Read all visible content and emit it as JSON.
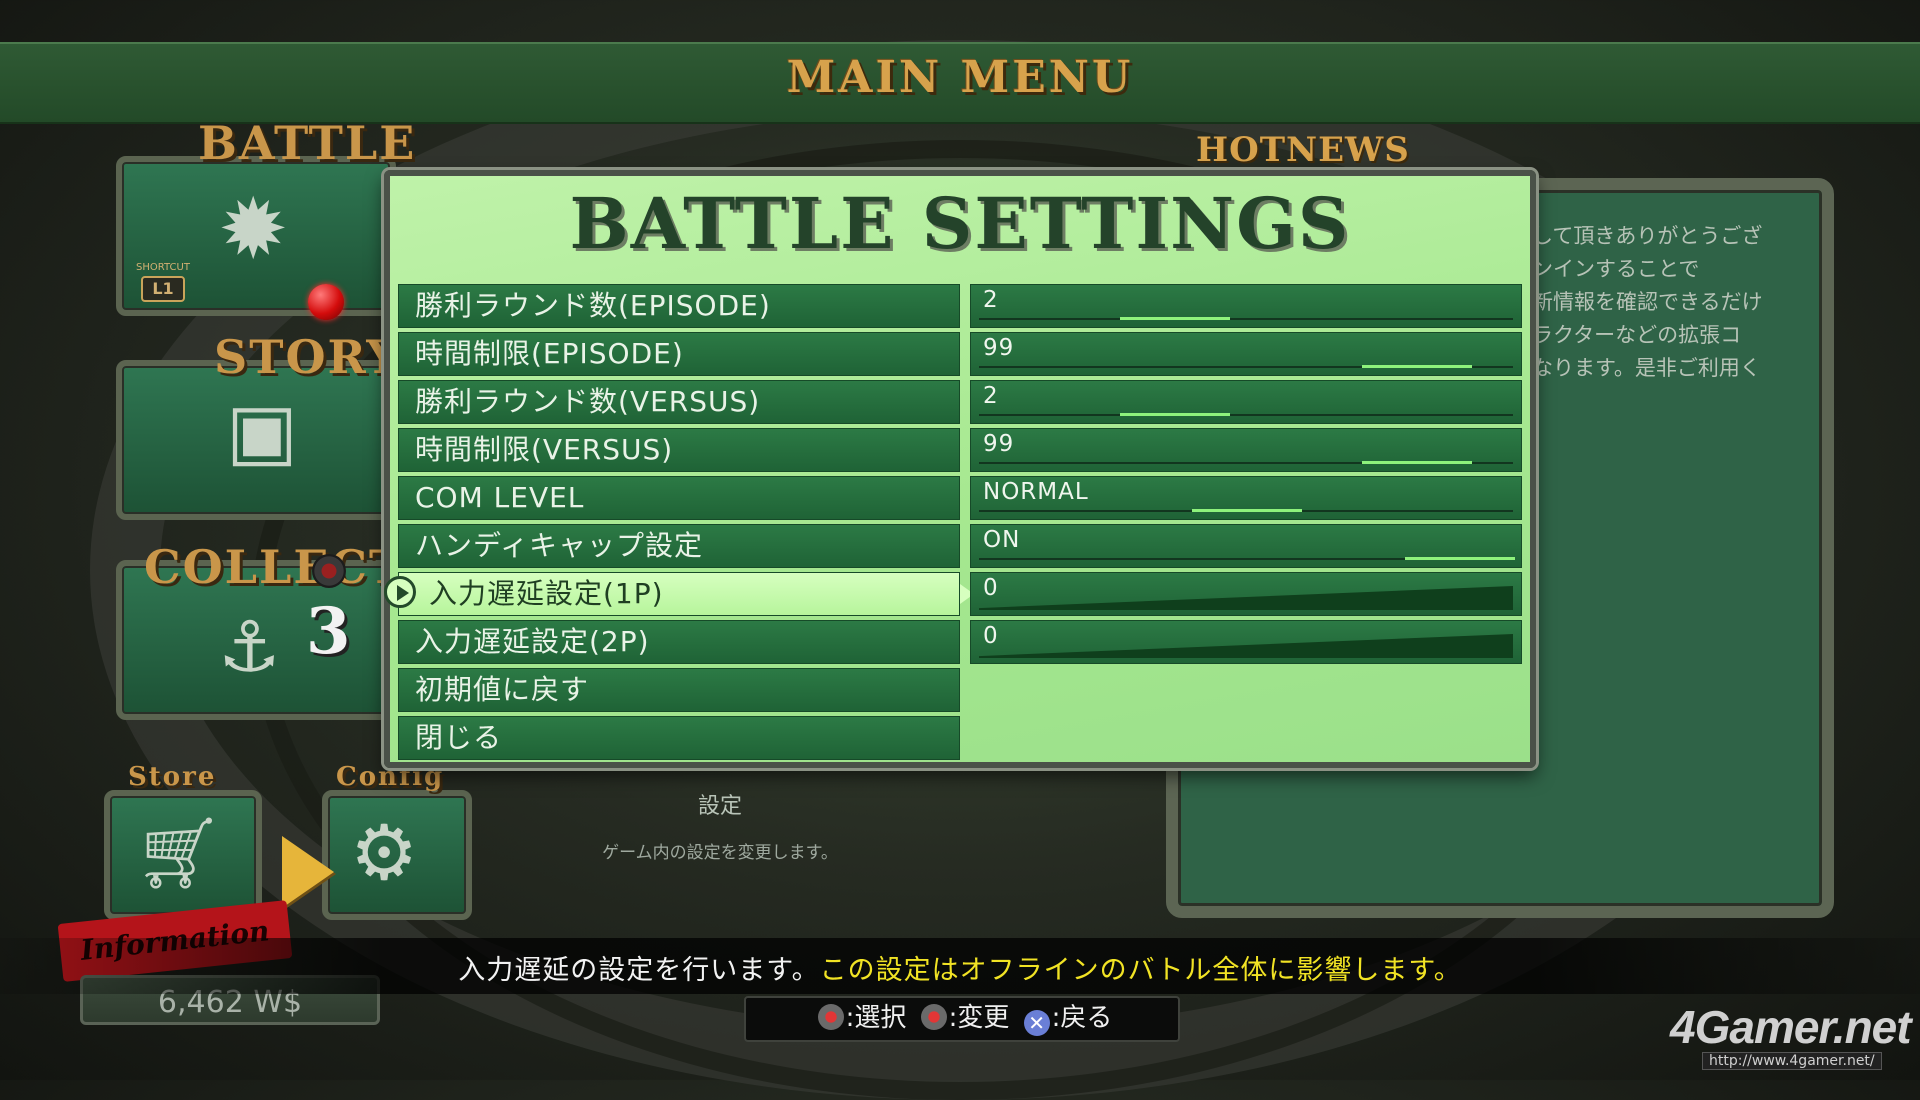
{
  "header": {
    "title": "MAIN MENU"
  },
  "left_menu": {
    "battle_label": "BATTLE",
    "shortcut_caption": "SHORTCUT",
    "shortcut_key": "L1",
    "story_label": "STORY",
    "collection_label": "COLLECTI",
    "collection_badge": "3",
    "store_label": "Store",
    "config_label": "Config",
    "information_label": "Information",
    "currency": "6,462 W$"
  },
  "config_caption": {
    "title": "設定",
    "description": "ゲーム内の設定を変更します。"
  },
  "hotnews": {
    "title": "HOTNEWS",
    "lines": [
      "して頂きありがとうござ",
      "ンインすることで",
      "新情報を確認できるだけ",
      "ラクターなどの拡張コ",
      "なります。是非ご利用く"
    ]
  },
  "dialog": {
    "title": "BATTLE SETTINGS",
    "rows": [
      {
        "label": "勝利ラウンド数(EPISODE)",
        "value": "2",
        "level": 0.33
      },
      {
        "label": "時間制限(EPISODE)",
        "value": "99",
        "level": 0.9
      },
      {
        "label": "勝利ラウンド数(VERSUS)",
        "value": "2",
        "level": 0.33
      },
      {
        "label": "時間制限(VERSUS)",
        "value": "99",
        "level": 0.9
      },
      {
        "label": "COM LEVEL",
        "value": "NORMAL",
        "level": 0.5
      },
      {
        "label": "ハンディキャップ設定",
        "value": "ON",
        "level": 1.0
      },
      {
        "label": "入力遅延設定(1P)",
        "value": "0",
        "selected": true
      },
      {
        "label": "入力遅延設定(2P)",
        "value": "0"
      },
      {
        "label": "初期値に戻す"
      },
      {
        "label": "閉じる"
      }
    ]
  },
  "footer": {
    "message_white": "入力遅延の設定を行います。",
    "message_yellow": "この設定はオフラインのバトル全体に影響します。",
    "select_label": ":選択",
    "change_label": ":変更",
    "back_label": ":戻る"
  },
  "watermark": {
    "logo": "4Gamer.net",
    "url": "http://www.4gamer.net/"
  },
  "colors": {
    "accent_gold": "#d7a24c",
    "dialog_green": "#a6e890",
    "row_green": "#2c7a45",
    "highlight_yellow": "#f1e324"
  }
}
